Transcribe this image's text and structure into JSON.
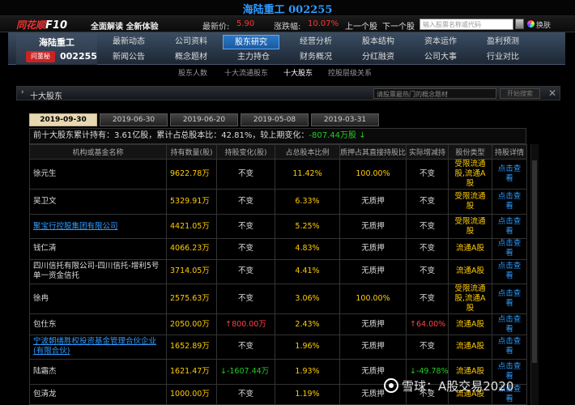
{
  "header": {
    "stock_title": "海陆重工 002255"
  },
  "quote": {
    "logo_text": "同花顺",
    "logo_f10": "F10",
    "slogan": "全面解读 全新体验",
    "price_label": "最新价:",
    "price": "5.90",
    "change_label": "涨跌幅:",
    "change": "10.07%",
    "prev": "上一个股",
    "next": "下一个股",
    "search_placeholder": "输入股票名称或代码",
    "skin": "换肤"
  },
  "company": {
    "name": "海陆重工",
    "ask": "问董秘",
    "code": "002255"
  },
  "menu": {
    "row1": [
      "最新动态",
      "公司资料",
      "股东研究",
      "经营分析",
      "股本结构",
      "资本运作",
      "盈利预测"
    ],
    "row2": [
      "新闻公告",
      "概念题材",
      "主力持仓",
      "财务概况",
      "分红融资",
      "公司大事",
      "行业对比"
    ],
    "active": "股东研究"
  },
  "subtabs": [
    "股东人数",
    "十大流通股东",
    "十大股东",
    "控股层级关系"
  ],
  "subtab_active": "十大股东",
  "panel": {
    "title": "十大股东",
    "search_placeholder": "请股票最热门的概念题材",
    "search_button": "开始搜索",
    "close": "✕"
  },
  "date_tabs": [
    "2019-09-30",
    "2019-06-30",
    "2019-06-20",
    "2019-05-08",
    "2019-03-31"
  ],
  "date_active": "2019-09-30",
  "summary": {
    "p1": "前十大股东累计持有：",
    "shares": "3.61",
    "p2": "亿股，累计占总股本比：",
    "ratio": "42.81%",
    "p3": "，较上期变化：",
    "change": "-807.44万股",
    "arrow": "↓"
  },
  "table": {
    "headers": [
      "机构或基金名称",
      "持有数量(股)",
      "持股变化(股)",
      "占总股本比例",
      "质押占其直接持股比",
      "实际增减持",
      "股份类型",
      "持股详情"
    ],
    "rows": [
      {
        "name": "徐元生",
        "link": false,
        "qty": "9622.78万",
        "chg": "不变",
        "chg_type": "same",
        "pct": "11.42%",
        "pledge": "100.00%",
        "pledge_type": "num",
        "actual": "不变",
        "actual_type": "same",
        "stype": "受限流通股,流通A股",
        "detail": "点击查看"
      },
      {
        "name": "吴卫文",
        "link": false,
        "qty": "5329.91万",
        "chg": "不变",
        "chg_type": "same",
        "pct": "6.33%",
        "pledge": "无质押",
        "pledge_type": "text",
        "actual": "不变",
        "actual_type": "same",
        "stype": "受限流通股",
        "detail": "点击查看"
      },
      {
        "name": "聚宝行控股集团有限公司",
        "link": true,
        "qty": "4421.05万",
        "chg": "不变",
        "chg_type": "same",
        "pct": "5.25%",
        "pledge": "无质押",
        "pledge_type": "text",
        "actual": "不变",
        "actual_type": "same",
        "stype": "受限流通股",
        "detail": "点击查看"
      },
      {
        "name": "钱仁清",
        "link": false,
        "qty": "4066.23万",
        "chg": "不变",
        "chg_type": "same",
        "pct": "4.83%",
        "pledge": "无质押",
        "pledge_type": "text",
        "actual": "不变",
        "actual_type": "same",
        "stype": "流通A股",
        "detail": "点击查看"
      },
      {
        "name": "四川信托有限公司-四川信托-增利5号单一资金信托",
        "link": false,
        "qty": "3714.05万",
        "chg": "不变",
        "chg_type": "same",
        "pct": "4.41%",
        "pledge": "无质押",
        "pledge_type": "text",
        "actual": "不变",
        "actual_type": "same",
        "stype": "流通A股",
        "detail": "点击查看"
      },
      {
        "name": "徐冉",
        "link": false,
        "qty": "2575.63万",
        "chg": "不变",
        "chg_type": "same",
        "pct": "3.06%",
        "pledge": "100.00%",
        "pledge_type": "num",
        "actual": "不变",
        "actual_type": "same",
        "stype": "受限流通股,流通A股",
        "detail": "点击查看"
      },
      {
        "name": "包仕东",
        "link": false,
        "qty": "2050.00万",
        "chg": "↑800.00万",
        "chg_type": "up",
        "pct": "2.43%",
        "pledge": "无质押",
        "pledge_type": "text",
        "actual": "↑64.00%",
        "actual_type": "up",
        "stype": "流通A股",
        "detail": "点击查看"
      },
      {
        "name": "宁波朝缮胜权投资基金管理合伙企业(有限合伙)",
        "link": true,
        "qty": "1652.89万",
        "chg": "不变",
        "chg_type": "same",
        "pct": "1.96%",
        "pledge": "无质押",
        "pledge_type": "text",
        "actual": "不变",
        "actual_type": "same",
        "stype": "流通A股",
        "detail": "点击查看"
      },
      {
        "name": "陆霜杰",
        "link": false,
        "qty": "1621.47万",
        "chg": "↓-1607.44万",
        "chg_type": "down",
        "pct": "1.93%",
        "pledge": "无质押",
        "pledge_type": "text",
        "actual": "↓-49.78%",
        "actual_type": "down",
        "stype": "流通A股",
        "detail": "点击查看"
      },
      {
        "name": "包清龙",
        "link": false,
        "qty": "1000.00万",
        "chg": "不变",
        "chg_type": "same",
        "pct": "1.19%",
        "pledge": "无质押",
        "pledge_type": "text",
        "actual": "不变",
        "actual_type": "same",
        "stype": "流通A股",
        "detail": "点击查看"
      }
    ]
  },
  "watermark": "雪球：A股交易2020"
}
